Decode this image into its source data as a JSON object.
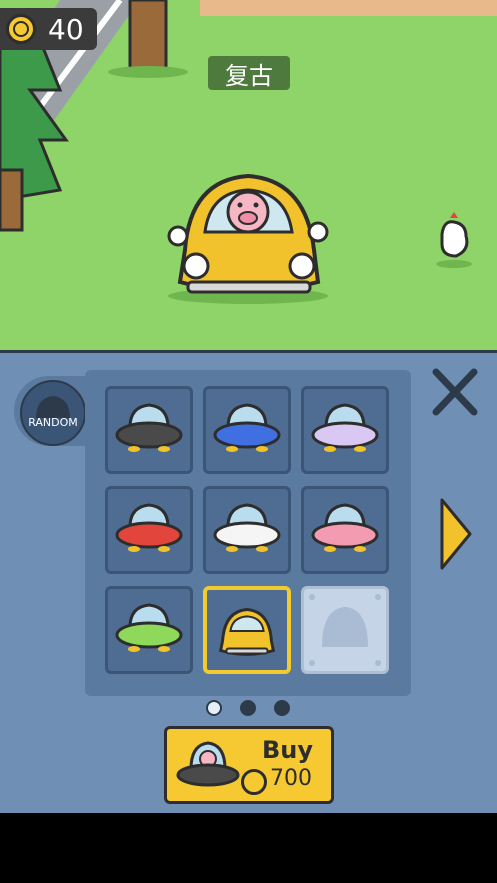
{
  "hud": {
    "coin_count": "40",
    "coin_icon": "coin-icon"
  },
  "scene": {
    "car_name": "复古"
  },
  "panel": {
    "random_label": "RANDOM",
    "close_icon": "close-icon",
    "next_icon": "chevron-right-icon",
    "vehicles": [
      {
        "name": "ufo-gray"
      },
      {
        "name": "ufo-blue"
      },
      {
        "name": "ufo-lavender"
      },
      {
        "name": "ufo-red"
      },
      {
        "name": "ufo-white"
      },
      {
        "name": "ufo-pink-donut"
      },
      {
        "name": "ufo-green-donut"
      },
      {
        "name": "retro-car-yellow",
        "selected": true
      },
      {
        "name": "locked-slot"
      }
    ],
    "page_dots": [
      {
        "active": true
      },
      {
        "active": false
      },
      {
        "active": false
      }
    ]
  },
  "buy": {
    "label": "Buy",
    "price": "700",
    "coin_icon": "coin-icon"
  },
  "colors": {
    "grass": "#8fd468",
    "panel": "#6f8fb4",
    "gold": "#f6c932",
    "outline": "#2d2d2d"
  }
}
